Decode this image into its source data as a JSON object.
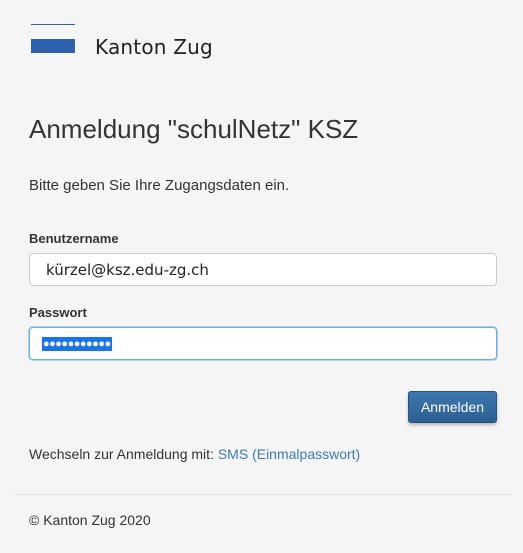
{
  "header": {
    "logo_text": "Kanton Zug",
    "brand_color": "#2f62ae"
  },
  "login": {
    "title": "Anmeldung \"schulNetz\" KSZ",
    "intro": "Bitte geben Sie Ihre Zugangsdaten ein.",
    "username_label": "Benutzername",
    "username_value": "kürzel@ksz.edu-zg.ch",
    "password_label": "Passwort",
    "password_masked": "●●●●●●●●●●●",
    "submit_label": "Anmelden",
    "switch_prefix": "Wechseln zur Anmeldung mit:",
    "switch_link": "SMS (Einmalpasswort)"
  },
  "footer": {
    "copyright": "© Kanton Zug 2020"
  }
}
